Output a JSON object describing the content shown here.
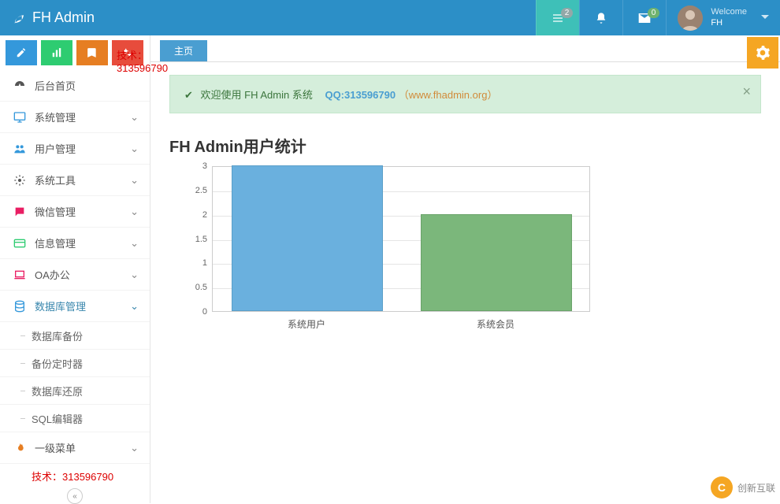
{
  "header": {
    "title": "FH Admin",
    "list_badge": "2",
    "mail_badge": "0",
    "welcome": "Welcome",
    "username": "FH"
  },
  "sidebar": {
    "tech_label": "技术：",
    "tech_num": "313596790",
    "items": [
      {
        "label": "后台首页",
        "icon": "dashboard-icon",
        "expandable": false
      },
      {
        "label": "系统管理",
        "icon": "monitor-icon",
        "color": "#3498db",
        "expandable": true
      },
      {
        "label": "用户管理",
        "icon": "users-icon",
        "color": "#3498db",
        "expandable": true
      },
      {
        "label": "系统工具",
        "icon": "gear-icon",
        "color": "#555",
        "expandable": true
      },
      {
        "label": "微信管理",
        "icon": "chat-icon",
        "color": "#e91e63",
        "expandable": true
      },
      {
        "label": "信息管理",
        "icon": "card-icon",
        "color": "#2ecc71",
        "expandable": true
      },
      {
        "label": "OA办公",
        "icon": "laptop-icon",
        "color": "#e91e63",
        "expandable": true
      },
      {
        "label": "数据库管理",
        "icon": "database-icon",
        "color": "#3498db",
        "expandable": true,
        "active": true,
        "children": [
          "数据库备份",
          "备份定时器",
          "数据库还原",
          "SQL编辑器"
        ]
      },
      {
        "label": "一级菜单",
        "icon": "flame-icon",
        "color": "#e67e22",
        "expandable": true
      }
    ]
  },
  "tabs": {
    "main": "主页"
  },
  "alert": {
    "text": "欢迎使用 FH Admin 系统",
    "qq": "QQ:313596790",
    "link_open": "（",
    "link": "www.fhadmin.org",
    "link_close": "）"
  },
  "chart_title": "FH Admin用户统计",
  "chart_data": {
    "type": "bar",
    "categories": [
      "系统用户",
      "系统会员"
    ],
    "values": [
      3,
      2
    ],
    "ylim": [
      0,
      3
    ],
    "ytick_step": 0.5,
    "yticks": [
      "0",
      "0.5",
      "1",
      "1.5",
      "2",
      "2.5",
      "3"
    ]
  },
  "footer_brand": "创新互联"
}
